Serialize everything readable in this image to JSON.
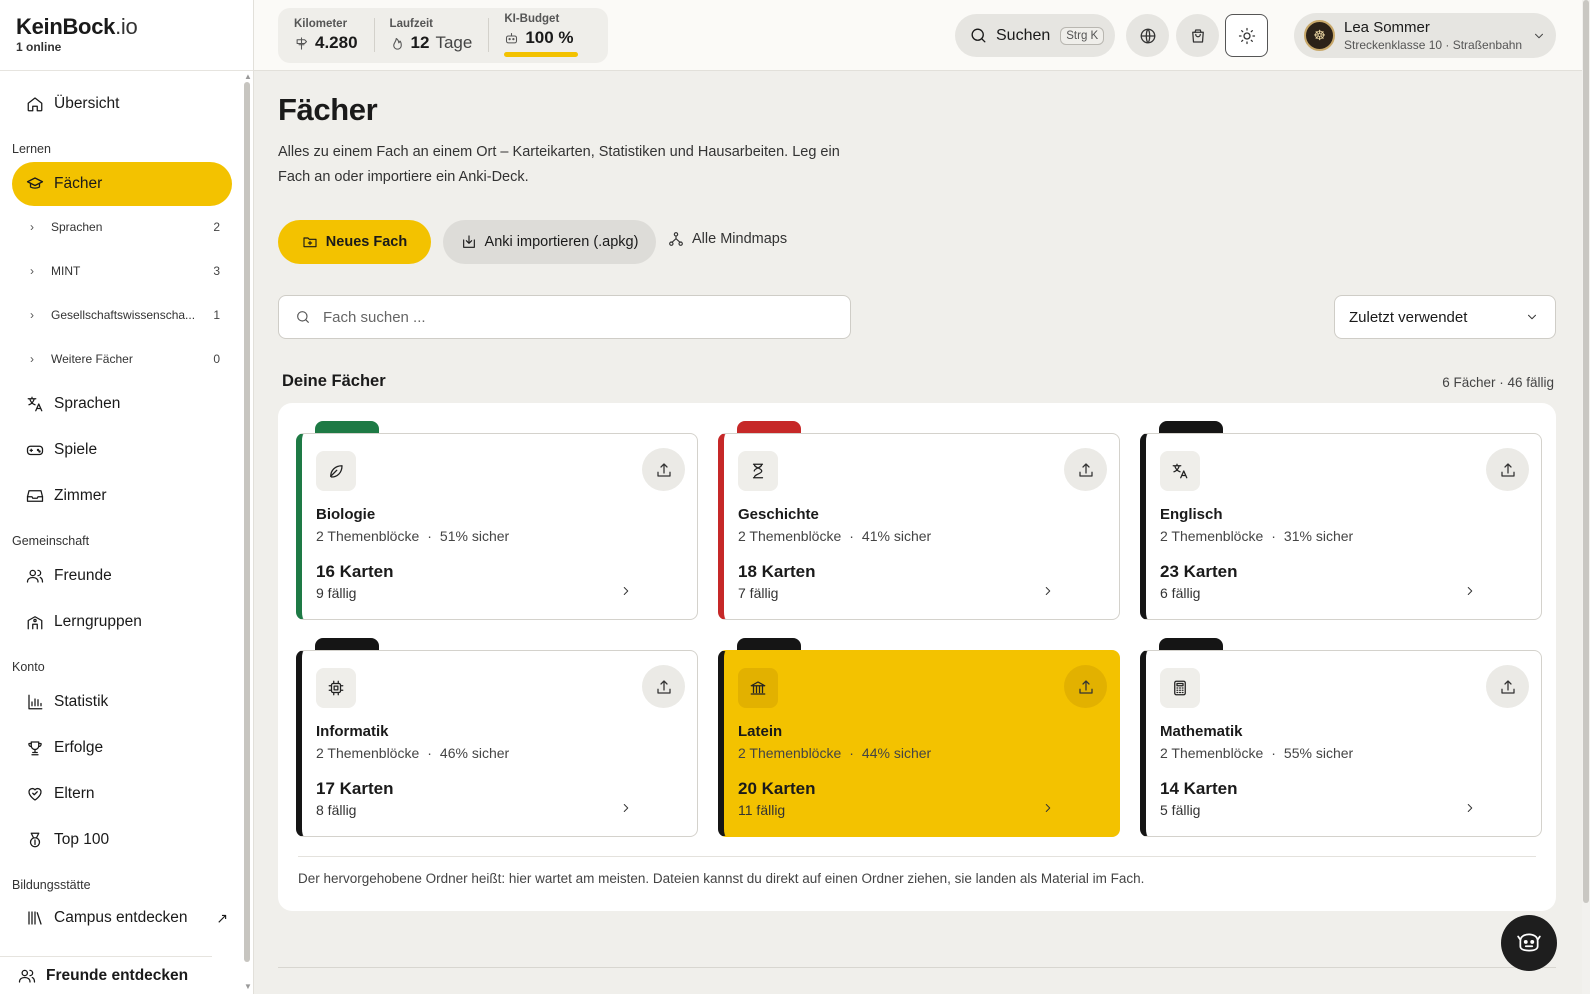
{
  "brand": {
    "name": "KeinBock",
    "tld": ".io",
    "online": "1 online"
  },
  "sidebar": {
    "overview": "Übersicht",
    "sections": {
      "learn": "Lernen",
      "community": "Gemeinschaft",
      "account": "Konto",
      "institution": "Bildungsstätte"
    },
    "subjects": "Fächer",
    "sub_items": [
      {
        "label": "Sprachen",
        "count": "2"
      },
      {
        "label": "MINT",
        "count": "3"
      },
      {
        "label": "Gesellschaftswissenscha...",
        "count": "1"
      },
      {
        "label": "Weitere Fächer",
        "count": "0"
      }
    ],
    "languages": "Sprachen",
    "games": "Spiele",
    "room": "Zimmer",
    "friends": "Freunde",
    "study_groups": "Lerngruppen",
    "statistics": "Statistik",
    "achievements": "Erfolge",
    "parents": "Eltern",
    "top100": "Top 100",
    "campus": "Campus entdecken",
    "discover_friends": "Freunde entdecken"
  },
  "topbar": {
    "km_label": "Kilometer",
    "km_value": "4.280",
    "streak_label": "Laufzeit",
    "streak_value": "12",
    "streak_unit": "Tage",
    "budget_label": "KI-Budget",
    "budget_value": "100 %",
    "budget_fraction": 1.0,
    "search_label": "Suchen",
    "search_kbd": "Strg K",
    "user_name": "Lea Sommer",
    "user_sub": "Streckenklasse 10 · Straßenbahn"
  },
  "main": {
    "title": "Fächer",
    "description": "Alles zu einem Fach an einem Ort – Karteikarten, Statistiken und Hausarbeiten. Leg ein Fach an oder importiere ein Anki-Deck.",
    "new_subject": "Neues Fach",
    "import_anki": "Anki importieren (.apkg)",
    "all_mindmaps": "Alle Mindmaps",
    "search_placeholder": "Fach suchen ...",
    "sort_value": "Zuletzt verwendet",
    "section_title": "Deine Fächer",
    "section_meta": "6 Fächer · 46 fällig",
    "note": "Der hervorgehobene Ordner heißt: hier wartet am meisten. Dateien kannst du direkt auf einen Ordner ziehen, sie landen als Material im Fach."
  },
  "subjects": [
    {
      "name": "Biologie",
      "blocks": "2 Themenblöcke",
      "sure": "51% sicher",
      "cards": "16 Karten",
      "due": "9 fällig",
      "color": "#1e7a45",
      "icon": "leaf-icon",
      "highlight": false
    },
    {
      "name": "Geschichte",
      "blocks": "2 Themenblöcke",
      "sure": "41% sicher",
      "cards": "18 Karten",
      "due": "7 fällig",
      "color": "#c62828",
      "icon": "hourglass-icon",
      "highlight": false
    },
    {
      "name": "Englisch",
      "blocks": "2 Themenblöcke",
      "sure": "31% sicher",
      "cards": "23 Karten",
      "due": "6 fällig",
      "color": "#151515",
      "icon": "translate-icon",
      "highlight": false
    },
    {
      "name": "Informatik",
      "blocks": "2 Themenblöcke",
      "sure": "46% sicher",
      "cards": "17 Karten",
      "due": "8 fällig",
      "color": "#151515",
      "icon": "cpu-icon",
      "highlight": false
    },
    {
      "name": "Latein",
      "blocks": "2 Themenblöcke",
      "sure": "44% sicher",
      "cards": "20 Karten",
      "due": "11 fällig",
      "color": "#151515",
      "icon": "columns-icon",
      "highlight": true
    },
    {
      "name": "Mathematik",
      "blocks": "2 Themenblöcke",
      "sure": "55% sicher",
      "cards": "14 Karten",
      "due": "5 fällig",
      "color": "#151515",
      "icon": "calculator-icon",
      "highlight": false
    }
  ]
}
